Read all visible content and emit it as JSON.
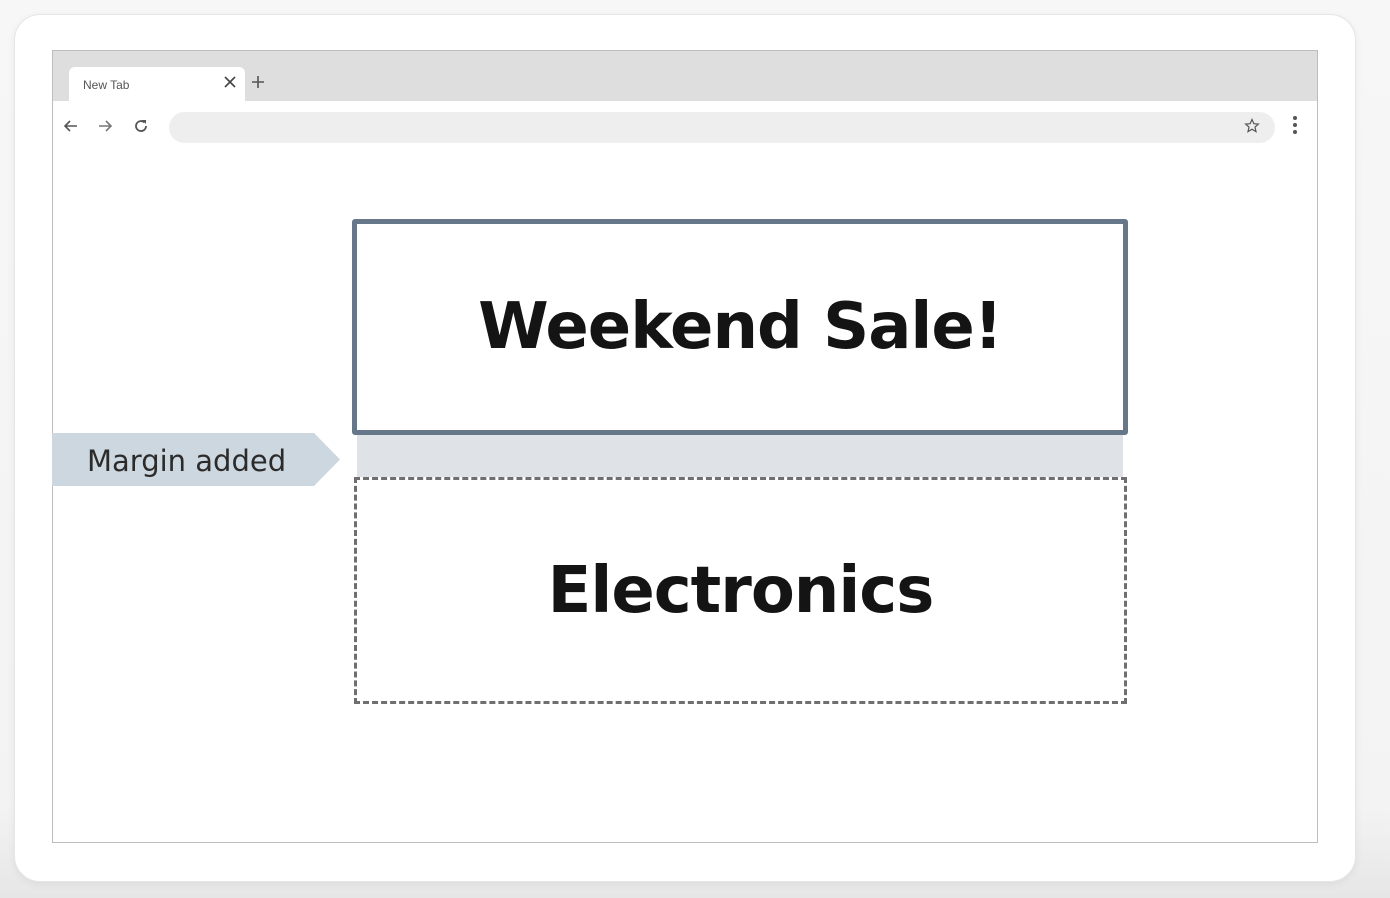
{
  "browser": {
    "tab": {
      "title": "New Tab",
      "close_icon": "close-icon"
    },
    "new_tab_icon": "plus-icon",
    "toolbar": {
      "back_icon": "arrow-left-icon",
      "forward_icon": "arrow-right-icon",
      "reload_icon": "reload-icon",
      "address_value": "",
      "bookmark_icon": "star-icon",
      "menu_icon": "vertical-dots-icon"
    }
  },
  "page": {
    "sale_heading": "Weekend Sale!",
    "electronics_heading": "Electronics"
  },
  "annotation": {
    "margin_label": "Margin added"
  },
  "colors": {
    "sale_border": "#67778a",
    "margin_highlight": "#dfe3e8",
    "callout_fill": "#cdd7df",
    "dashed_border": "#6f6f6f"
  }
}
